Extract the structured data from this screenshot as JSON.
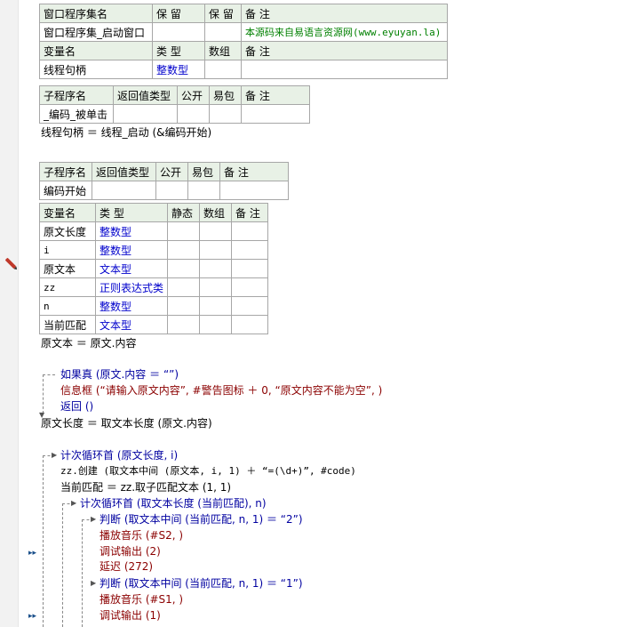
{
  "window_table": {
    "headers": [
      "窗口程序集名",
      "保 留",
      "保 留",
      "备 注"
    ],
    "row": [
      "窗口程序集_启动窗口",
      "",
      "",
      "本源码来自易语言资源网(www.eyuyan.la)"
    ],
    "var_headers": [
      "变量名",
      "类 型",
      "数组",
      "备 注"
    ],
    "var_row": [
      "线程句柄",
      "整数型",
      "",
      ""
    ]
  },
  "sub1_table": {
    "headers": [
      "子程序名",
      "返回值类型",
      "公开",
      "易包",
      "备 注"
    ],
    "row": [
      "_编码_被单击",
      "",
      "",
      "",
      ""
    ]
  },
  "sub1_code": [
    "线程句柄 ＝ 线程_启动 (&编码开始)"
  ],
  "sub2_table": {
    "headers": [
      "子程序名",
      "返回值类型",
      "公开",
      "易包",
      "备 注"
    ],
    "row": [
      "编码开始",
      "",
      "",
      "",
      ""
    ]
  },
  "locals_table": {
    "headers": [
      "变量名",
      "类 型",
      "静态",
      "数组",
      "备 注"
    ],
    "rows": [
      [
        "原文长度",
        "整数型"
      ],
      [
        "i",
        "整数型"
      ],
      [
        "原文本",
        "文本型"
      ],
      [
        "zz",
        "正则表达式类"
      ],
      [
        "n",
        "整数型"
      ],
      [
        "当前匹配",
        "文本型"
      ]
    ]
  },
  "code": {
    "l1": "原文本 ＝ 原文.内容",
    "l2": "如果真 (原文.内容 ＝ “”)",
    "l3": "信息框 (“请输入原文内容”, #警告图标 ＋ 0, “原文内容不能为空”, )",
    "l4": "返回 ()",
    "l5": "原文长度 ＝ 取文本长度 (原文.内容)",
    "l6": "计次循环首 (原文长度, i)",
    "l7": "zz.创建 (取文本中间 (原文本, i, 1) ＋ “=(\\d+)”, #code)",
    "l8": "当前匹配 ＝ zz.取子匹配文本 (1, 1)",
    "l9": "计次循环首 (取文本长度 (当前匹配), n)",
    "l10": "判断 (取文本中间 (当前匹配, n, 1) ＝ “2”)",
    "l11": "播放音乐 (#S2, )",
    "l12": "调试输出 (2)",
    "l13": "延迟 (272)",
    "l14": "判断 (取文本中间 (当前匹配, n, 1) ＝ “1”)",
    "l15": "播放音乐 (#S1, )",
    "l16": "调试输出 (1)"
  }
}
